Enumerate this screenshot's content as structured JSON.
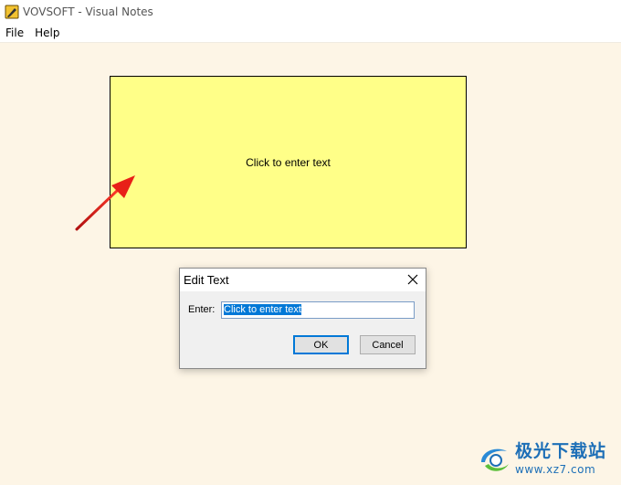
{
  "window": {
    "title": "VOVSOFT - Visual Notes",
    "icon": "pencil-note-icon"
  },
  "menu": {
    "items": [
      {
        "label": "File"
      },
      {
        "label": "Help"
      }
    ]
  },
  "canvas": {
    "background": "#fdf5e6",
    "note": {
      "text": "Click to enter text",
      "color": "#ffff88"
    },
    "annotation_arrow_color": "#e02020"
  },
  "dialog": {
    "title": "Edit Text",
    "field_label": "Enter:",
    "field_value": "Click to enter text",
    "ok_label": "OK",
    "cancel_label": "Cancel",
    "close_icon": "close-icon"
  },
  "watermark": {
    "brand_text": "极光下载站",
    "url_text": "www.xz7.com",
    "color": "#1d6fb7"
  }
}
